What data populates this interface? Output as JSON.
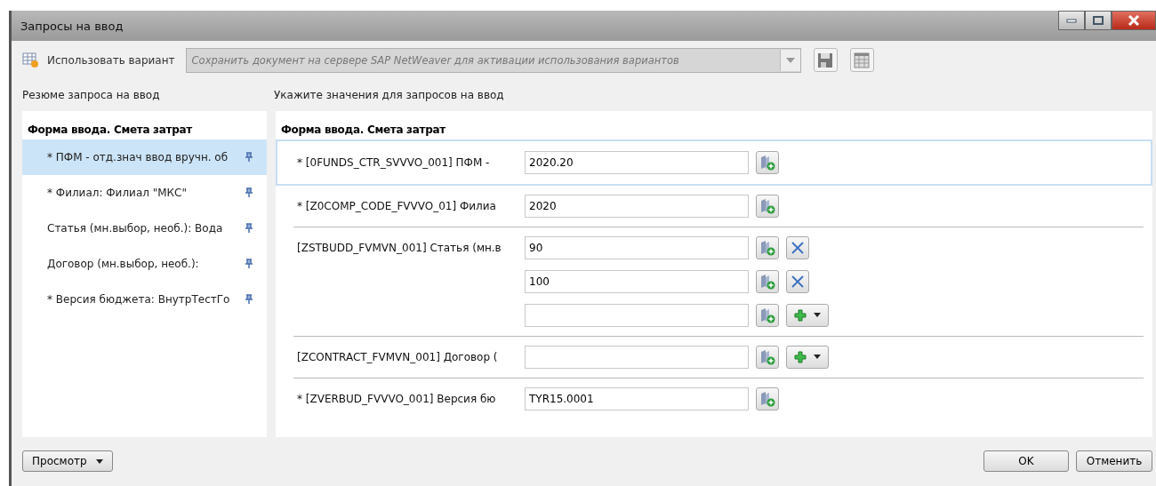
{
  "window": {
    "title": "Запросы на ввод"
  },
  "variant": {
    "label": "Использовать вариант",
    "placeholder": "Сохранить документ на сервере SAP NetWeaver для активации использования вариантов"
  },
  "summary": {
    "heading": "Резюме запроса на ввод",
    "title": "Форма ввода. Смета затрат",
    "items": [
      {
        "label": "* ПФМ - отд.знач ввод вручн. об",
        "selected": true
      },
      {
        "label": "* Филиал: Филиал \"МКС\"",
        "selected": false
      },
      {
        "label": "Статья (мн.выбор, необ.): Вода",
        "selected": false
      },
      {
        "label": "Договор (мн.выбор, необ.):",
        "selected": false
      },
      {
        "label": "* Версия бюджета: ВнутрТестГо",
        "selected": false
      }
    ]
  },
  "prompts": {
    "heading": "Укажите значения для запросов на ввод",
    "title": "Форма ввода. Смета затрат",
    "groups": [
      {
        "label": "* [0FUNDS_CTR_SVVVO_001] ПФМ -",
        "selected": true,
        "values": [
          {
            "value": "2020.20",
            "kind": "single"
          }
        ]
      },
      {
        "label": "* [Z0COMP_CODE_FVVVO_01] Филиа",
        "selected": false,
        "values": [
          {
            "value": "2020",
            "kind": "single"
          }
        ]
      },
      {
        "label": "[ZSTBUDD_FVMVN_001]  Статья (мн.в",
        "selected": false,
        "values": [
          {
            "value": "90",
            "kind": "remove"
          },
          {
            "value": "100",
            "kind": "remove"
          },
          {
            "kind": "add"
          }
        ]
      },
      {
        "label": "[ZCONTRACT_FVMVN_001]  Договор (",
        "selected": false,
        "values": [
          {
            "kind": "add"
          }
        ]
      },
      {
        "label": "* [ZVERBUD_FVVVO_001]  Версия бю",
        "selected": false,
        "values": [
          {
            "value": "TYR15.0001",
            "kind": "single"
          }
        ]
      }
    ]
  },
  "footer": {
    "view_button": "Просмотр",
    "ok_button": "OK",
    "cancel_button": "Отменить"
  }
}
